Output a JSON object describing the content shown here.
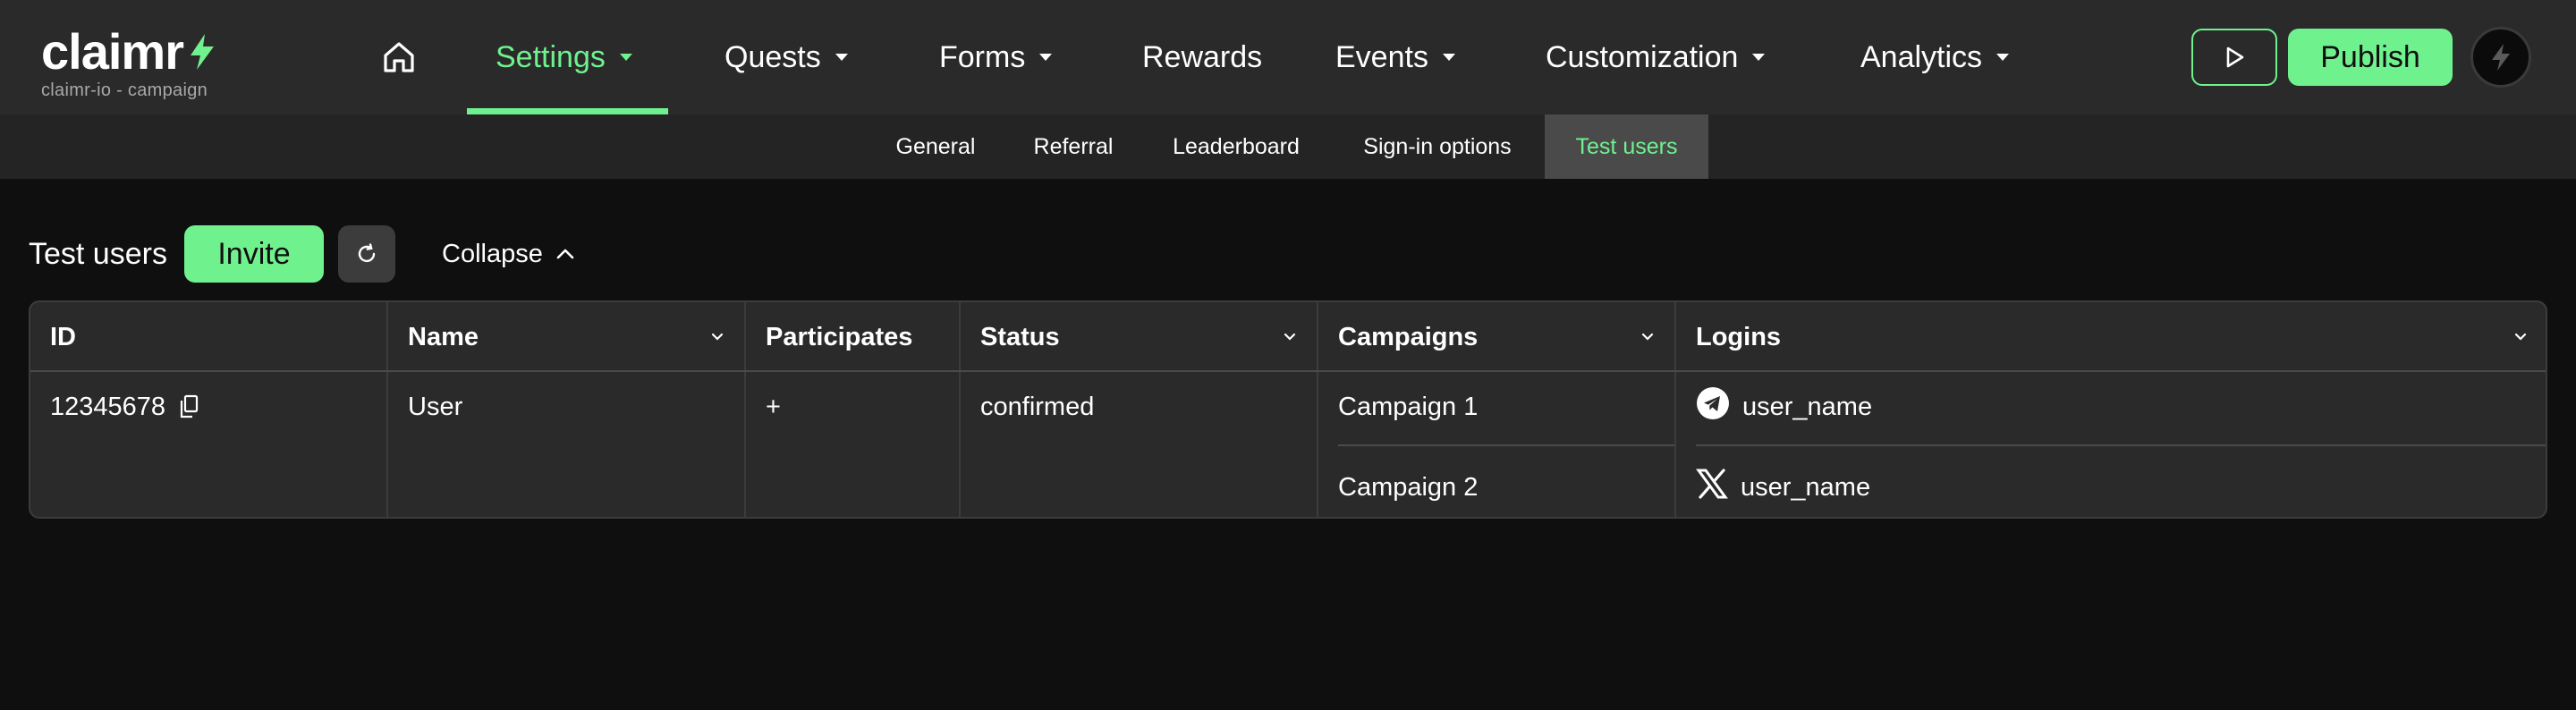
{
  "app": {
    "logo_text": "claimr",
    "subtitle": "claimr-io - campaign"
  },
  "nav": {
    "items": [
      {
        "label": "Settings",
        "has_dropdown": true,
        "active": true
      },
      {
        "label": "Quests",
        "has_dropdown": true
      },
      {
        "label": "Forms",
        "has_dropdown": true
      },
      {
        "label": "Rewards",
        "has_dropdown": false
      },
      {
        "label": "Events",
        "has_dropdown": true
      },
      {
        "label": "Customization",
        "has_dropdown": true
      },
      {
        "label": "Analytics",
        "has_dropdown": true
      }
    ],
    "publish_label": "Publish"
  },
  "subnav": {
    "tabs": [
      {
        "label": "General"
      },
      {
        "label": "Referral"
      },
      {
        "label": "Leaderboard"
      },
      {
        "label": "Sign-in options"
      },
      {
        "label": "Test users",
        "active": true
      }
    ]
  },
  "section": {
    "title": "Test users",
    "invite_label": "Invite",
    "collapse_label": "Collapse"
  },
  "table": {
    "headers": [
      "ID",
      "Name",
      "Participates",
      "Status",
      "Campaigns",
      "Logins"
    ],
    "rows": [
      {
        "id": "12345678",
        "name": "User",
        "participates": "+",
        "status": "confirmed",
        "campaigns": [
          "Campaign 1",
          "Campaign 2"
        ],
        "logins": [
          {
            "icon": "telegram-icon",
            "username": "user_name"
          },
          {
            "icon": "x-icon",
            "username": "user_name"
          }
        ]
      }
    ]
  },
  "colors": {
    "accent": "#6ff28e",
    "background": "#0f0f0f",
    "topbar": "#2a2a2a",
    "table_bg": "#2a2a2a"
  }
}
